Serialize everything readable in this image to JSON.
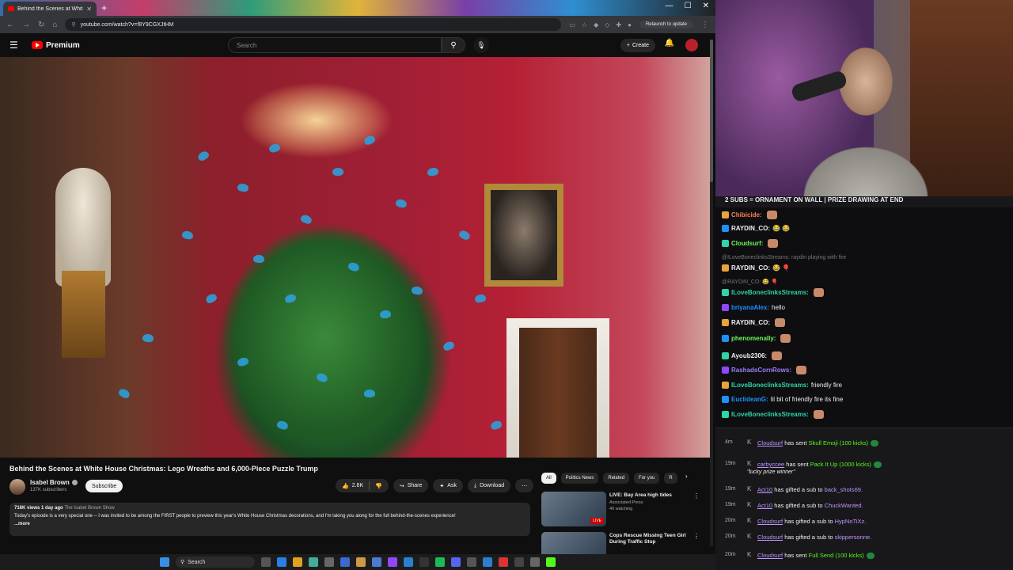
{
  "browser": {
    "tab_title": "Behind the Scenes at Whit",
    "url": "youtube.com/watch?v=f8Y9CGXJtHM",
    "relaunch_label": "Relaunch to update"
  },
  "youtube": {
    "logo_text": "Premium",
    "search_placeholder": "Search",
    "create_label": "Create",
    "video": {
      "title": "Behind the Scenes at White House Christmas: Lego Wreaths and 6,000-Piece Puzzle Trump",
      "channel": "Isabel Brown",
      "subscribers": "137K subscribers",
      "subscribe_label": "Subscribe",
      "likes": "2.8K",
      "share_label": "Share",
      "ask_label": "Ask",
      "download_label": "Download",
      "views_age": "716K views  1 day ago",
      "show_link": "The Isabel Brown Show",
      "description": "Today's episode is a very special one -- I was invited to be among the FIRST people to preview this year's White House Christmas decorations, and I'm taking you along for the full behind-the-scenes experience!",
      "more_label": "...more"
    },
    "chips": [
      "All",
      "Politics News",
      "Related",
      "For you",
      "R"
    ],
    "recommendations": [
      {
        "title": "LIVE: Bay Area high tides",
        "channel": "Associated Press",
        "meta": "40 watching",
        "badge": "LIVE"
      },
      {
        "title": "Cops Rescue Missing Teen Girl During Traffic Stop",
        "channel": "",
        "meta": "",
        "badge": ""
      }
    ]
  },
  "chat": {
    "goal": "2 SUBS = ORNAMENT ON WALL | PRIZE DRAWING AT END",
    "messages": [
      {
        "user": "Chibicide:",
        "text": "",
        "color": "#ff7f50"
      },
      {
        "user": "RAYDIN_CO:",
        "text": "😂 😂",
        "color": "#efeff1"
      },
      {
        "user": "Cloudsurf:",
        "text": "",
        "color": "#6bf55a"
      },
      {
        "user": "",
        "text": "@ILoveBoneclinksStreams: raydin playing with fire",
        "color": "#777",
        "reply": true
      },
      {
        "user": "RAYDIN_CO:",
        "text": "😂 🎈",
        "color": "#efeff1"
      },
      {
        "user": "",
        "text": "@RAYDIN_CO: 😂 🎈",
        "color": "#777",
        "reply": true
      },
      {
        "user": "ILoveBoneclinksStreams:",
        "text": "",
        "color": "#2fd4a8"
      },
      {
        "user": "briyanaAlex:",
        "text": "hello",
        "color": "#1e90ff"
      },
      {
        "user": "RAYDIN_CO:",
        "text": "",
        "color": "#efeff1"
      },
      {
        "user": "phenomenally:",
        "text": "",
        "color": "#6bf55a"
      },
      {
        "user": "Ayoub2306:",
        "text": "",
        "color": "#efeff1"
      },
      {
        "user": "RashadsCornRows:",
        "text": "",
        "color": "#9b7dff"
      },
      {
        "user": "ILoveBoneclinksStreams:",
        "text": "friendly fire",
        "color": "#2fd4a8"
      },
      {
        "user": "EuclideanG:",
        "text": "lil bit of friendly fire its fine",
        "color": "#1e90ff"
      },
      {
        "user": "ILoveBoneclinksStreams:",
        "text": "",
        "color": "#2fd4a8"
      }
    ]
  },
  "feed": [
    {
      "time": "4m",
      "who": "Cloudsurf",
      "verb": "has sent",
      "what": "Skull Emoji (100 kicks)",
      "green": true,
      "kick": true,
      "quote": ""
    },
    {
      "time": "19m",
      "who": "carbyccee",
      "verb": "has sent",
      "what": "Pack It Up (1000 kicks)",
      "green": true,
      "kick": true,
      "quote": "\"lucky prize winner\""
    },
    {
      "time": "19m",
      "who": "Act10",
      "verb": "has gifted a sub to",
      "what": "back_shots69.",
      "green": false,
      "kick": false,
      "quote": ""
    },
    {
      "time": "19m",
      "who": "Act10",
      "verb": "has gifted a sub to",
      "what": "ChuckWanted.",
      "green": false,
      "kick": false,
      "quote": ""
    },
    {
      "time": "20m",
      "who": "Cloudsurf",
      "verb": "has gifted a sub to",
      "what": "HypNoTiXz.",
      "green": false,
      "kick": false,
      "quote": ""
    },
    {
      "time": "20m",
      "who": "Cloudsurf",
      "verb": "has gifted a sub to",
      "what": "skippersonne.",
      "green": false,
      "kick": false,
      "quote": ""
    },
    {
      "time": "20m",
      "who": "Cloudsurf",
      "verb": "has sent",
      "what": "Full Send (100 kicks)",
      "green": true,
      "kick": true,
      "quote": ""
    }
  ],
  "taskbar": {
    "search_label": "Search"
  }
}
